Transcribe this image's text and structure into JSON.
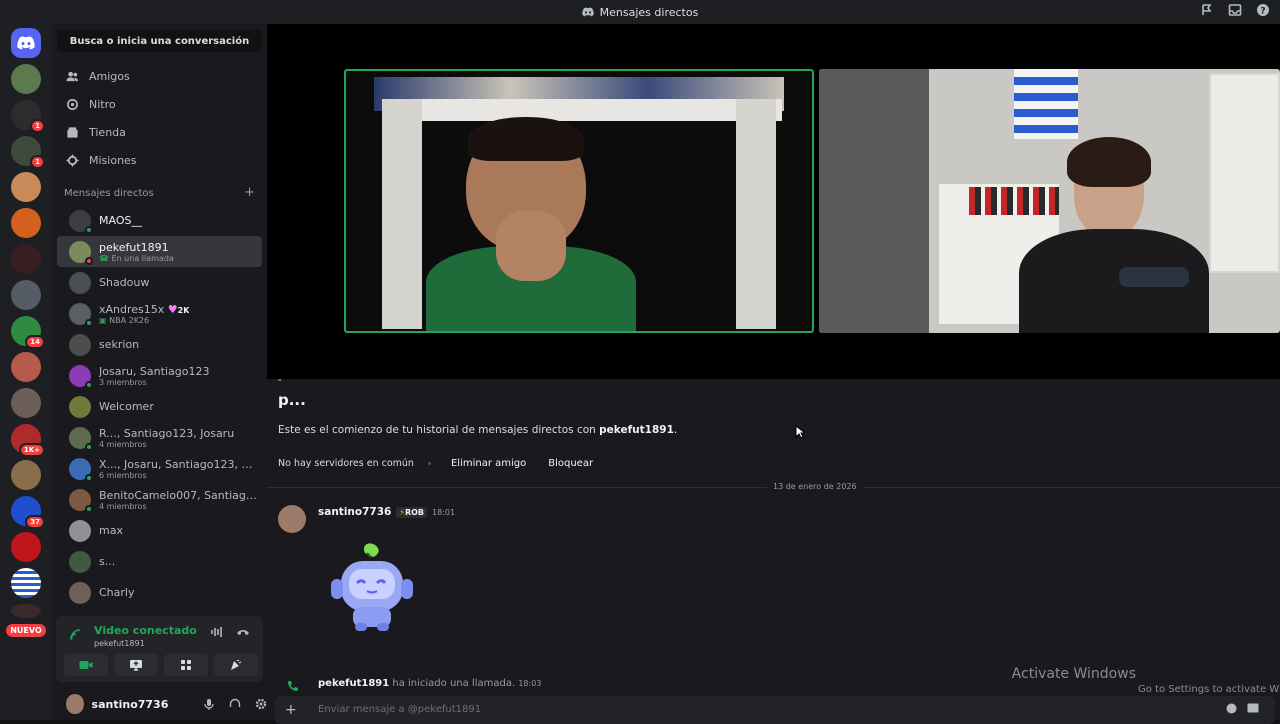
{
  "titlebar": {
    "title": "Mensajes directos"
  },
  "servers": {
    "badges": [
      "1",
      "1",
      "14",
      "1K+",
      "37"
    ],
    "new_label": "NUEVO"
  },
  "dm_panel": {
    "search_placeholder": "Busca o inicia una conversación",
    "nav": [
      {
        "label": "Amigos",
        "icon": "friends-icon"
      },
      {
        "label": "Nitro",
        "icon": "nitro-icon"
      },
      {
        "label": "Tienda",
        "icon": "shop-icon"
      },
      {
        "label": "Misiones",
        "icon": "quests-icon"
      }
    ],
    "section_title": "Mensajes directos",
    "dms": [
      {
        "name": "MAOS__",
        "sub": ""
      },
      {
        "name": "pekefut1891",
        "sub": "En una llamada"
      },
      {
        "name": "Shadouw",
        "sub": ""
      },
      {
        "name": "xAndres15x",
        "tag": "2K",
        "sub": "NBA 2K26"
      },
      {
        "name": "sekrion",
        "sub": ""
      },
      {
        "name": "Josaru, Santiago123",
        "sub": "3 miembros"
      },
      {
        "name": "Welcomer",
        "sub": ""
      },
      {
        "name": "R..., Santiago123, Josaru",
        "sub": "4 miembros"
      },
      {
        "name": "X..., Josaru, Santiago123, R...,...",
        "sub": "6 miembros"
      },
      {
        "name": "BenitoCamelo007, Santiago1...",
        "sub": "4 miembros"
      },
      {
        "name": "max",
        "sub": ""
      },
      {
        "name": "s...",
        "sub": ""
      },
      {
        "name": "Charly",
        "sub": ""
      }
    ],
    "voice": {
      "status": "Video conectado",
      "channel": "pekefut1891"
    },
    "user": {
      "name": "santino7736"
    }
  },
  "chat": {
    "header_name": "p...",
    "intro_prefix": "Este es el comienzo de tu historial de mensajes directos con ",
    "intro_user": "pekefut1891",
    "intro_suffix": ".",
    "no_servers": "No hay servidores en común",
    "remove_friend": "Eliminar amigo",
    "block": "Bloquear",
    "date": "13 de enero de 2026",
    "message": {
      "author": "santino7736",
      "tag": "ROB",
      "time": "18:01"
    },
    "call_event": {
      "user": "pekefut1891",
      "text": " ha iniciado una llamada.",
      "time": "18:03"
    },
    "composer_placeholder": "Enviar mensaje a @pekefut1891"
  },
  "watermark": {
    "line1": "Activate Windows",
    "line2": "Go to Settings to activate Windows."
  },
  "colors": {
    "accent": "#5865f2",
    "online": "#23a55a",
    "danger": "#f23f42"
  }
}
